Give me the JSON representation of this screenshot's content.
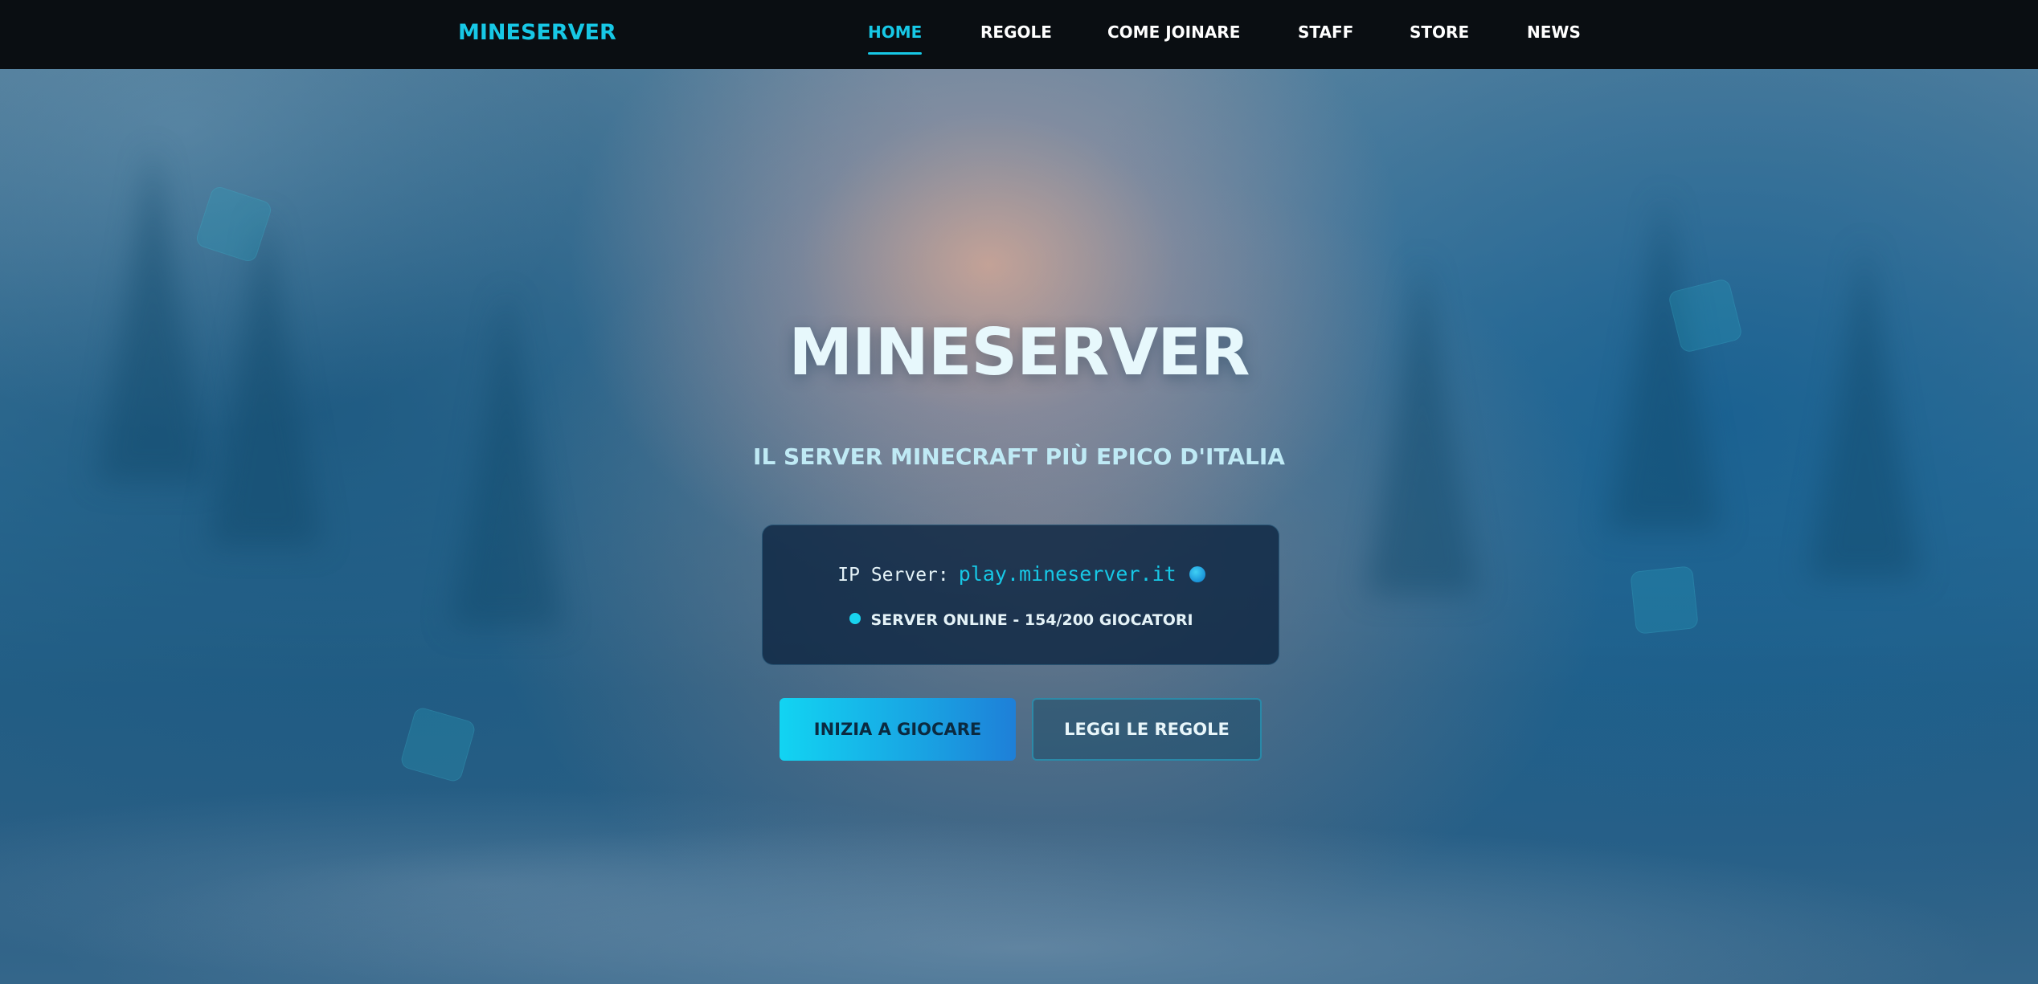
{
  "nav": {
    "logo": "MINESERVER",
    "links": [
      {
        "label": "HOME",
        "active": true
      },
      {
        "label": "REGOLE",
        "active": false
      },
      {
        "label": "COME JOINARE",
        "active": false
      },
      {
        "label": "STAFF",
        "active": false
      },
      {
        "label": "STORE",
        "active": false
      },
      {
        "label": "NEWS",
        "active": false
      }
    ]
  },
  "hero": {
    "title": "MINESERVER",
    "subtitle": "IL SERVER MINECRAFT PIÙ EPICO D'ITALIA"
  },
  "server": {
    "ip_label": "IP Server:",
    "ip_value": "play.mineserver.it",
    "copy_icon": "copy-dot-icon",
    "status_icon": "online-dot-icon",
    "status_text": "SERVER ONLINE - 154/200 GIOCATORI"
  },
  "buttons": {
    "primary": "INIZIA A GIOCARE",
    "secondary": "LEGGI LE REGOLE"
  },
  "colors": {
    "accent": "#17c8e6",
    "nav_bg": "#0a0e12",
    "card_bg": "#0e2642",
    "text_light": "#e7f8fc"
  }
}
